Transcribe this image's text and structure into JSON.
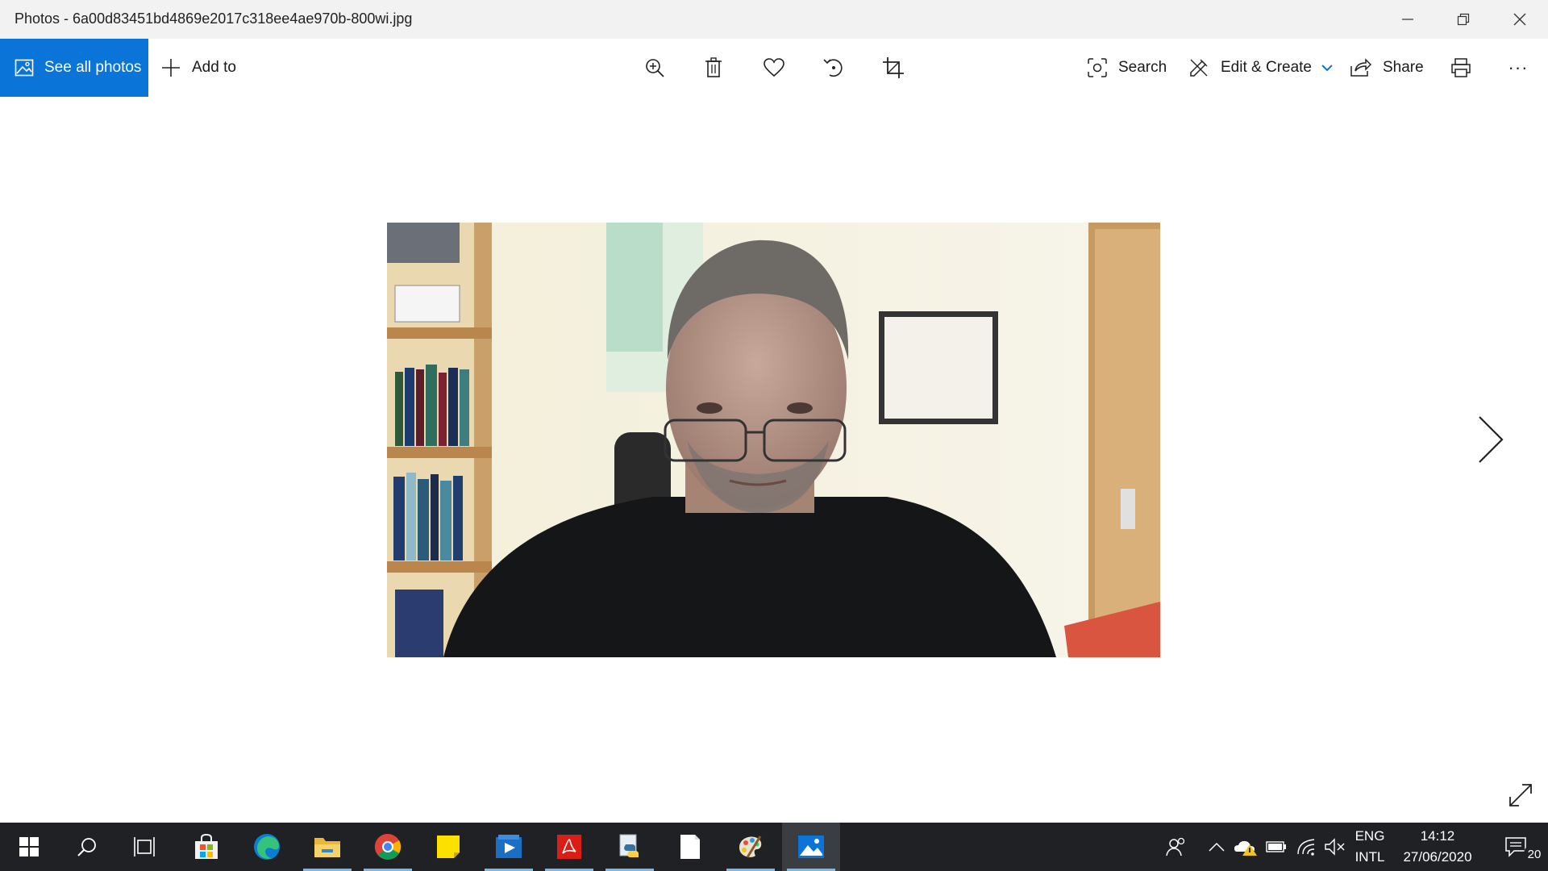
{
  "window": {
    "title": "Photos - 6a00d83451bd4869e2017c318ee4ae970b-800wi.jpg"
  },
  "toolbar": {
    "see_all_photos": "See all photos",
    "add_to": "Add to",
    "search": "Search",
    "edit_create": "Edit & Create",
    "share": "Share",
    "more": "···"
  },
  "taskbar": {
    "language": "ENG",
    "layout": "INTL",
    "time": "14:12",
    "date": "27/06/2020",
    "notification_count": "20",
    "apps": [
      "start-icon",
      "search-icon",
      "task-view-icon",
      "store-icon",
      "edge-icon",
      "file-explorer-icon",
      "chrome-icon",
      "sticky-notes-icon",
      "video-editor-icon",
      "acrobat-icon",
      "python-icon",
      "notepad-icon",
      "paint-icon",
      "photos-icon"
    ]
  },
  "colors": {
    "accent": "#0a74d8",
    "taskbar": "#1f2125",
    "titlebar": "#f2f2f2"
  }
}
